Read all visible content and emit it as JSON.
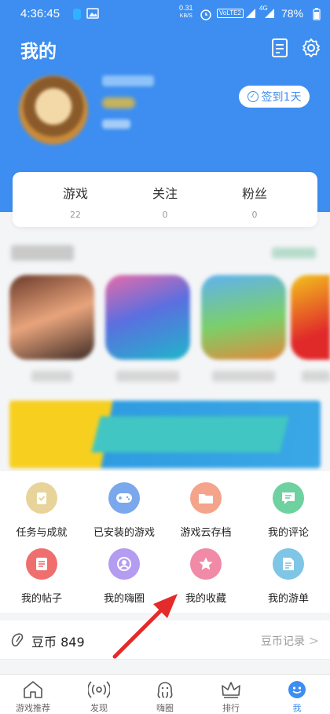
{
  "status_bar": {
    "time": "4:36:45",
    "network_speed": "0.31",
    "network_unit": "KB/S",
    "volte": "VoLTE2",
    "net_type": "4G",
    "battery": "78%"
  },
  "header": {
    "title": "我的",
    "signin_label": "签到1天"
  },
  "stats": [
    {
      "label": "游戏",
      "value": "22"
    },
    {
      "label": "关注",
      "value": "0"
    },
    {
      "label": "粉丝",
      "value": "0"
    }
  ],
  "features": [
    {
      "label": "任务与成就",
      "color": "#e8d49a",
      "icon": "task-icon"
    },
    {
      "label": "已安装的游戏",
      "color": "#7ba7ec",
      "icon": "gamepad-icon"
    },
    {
      "label": "游戏云存档",
      "color": "#f3a48a",
      "icon": "folder-icon"
    },
    {
      "label": "我的评论",
      "color": "#6ed1a0",
      "icon": "comment-icon"
    },
    {
      "label": "我的帖子",
      "color": "#ef6f6f",
      "icon": "post-icon"
    },
    {
      "label": "我的嗨圈",
      "color": "#b49cf0",
      "icon": "circle-icon"
    },
    {
      "label": "我的收藏",
      "color": "#f08aa6",
      "icon": "star-icon"
    },
    {
      "label": "我的游单",
      "color": "#7ec5e6",
      "icon": "list-icon"
    }
  ],
  "coins": {
    "text": "豆币 849",
    "link": "豆币记录"
  },
  "tabs": [
    {
      "label": "游戏推荐",
      "icon": "home-icon",
      "active": false
    },
    {
      "label": "发现",
      "icon": "discover-icon",
      "active": false
    },
    {
      "label": "嗨圈",
      "icon": "octopus-icon",
      "active": false
    },
    {
      "label": "排行",
      "icon": "crown-icon",
      "active": false
    },
    {
      "label": "我",
      "icon": "profile-icon",
      "active": true
    }
  ],
  "colors": {
    "primary": "#3d8ef0",
    "background": "#f4f5f7",
    "annotation_arrow": "#e32b2b"
  }
}
